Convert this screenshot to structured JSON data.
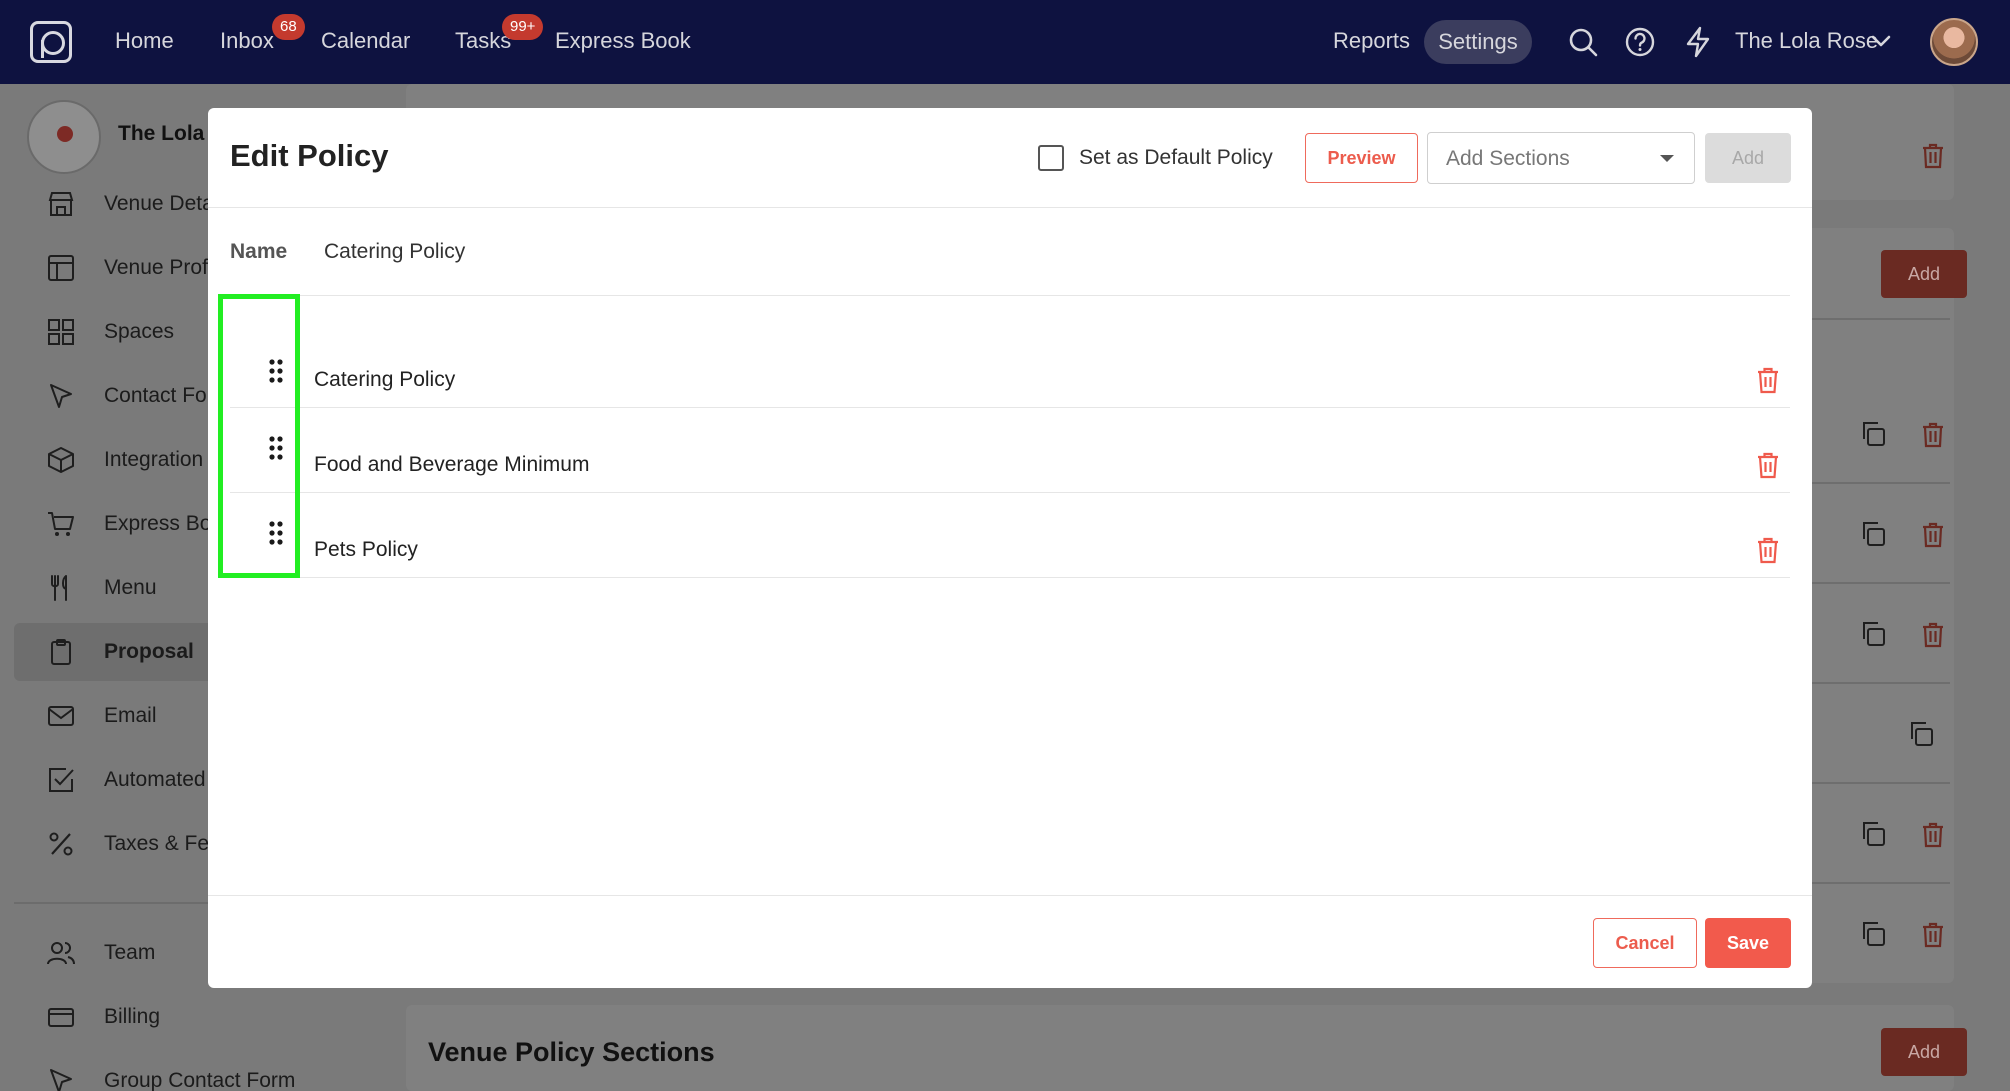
{
  "nav": {
    "home": "Home",
    "inbox": "Inbox",
    "inbox_badge": "68",
    "calendar": "Calendar",
    "tasks": "Tasks",
    "tasks_badge": "99+",
    "express_book": "Express Book",
    "reports": "Reports",
    "settings": "Settings",
    "account": "The Lola Rose"
  },
  "sidebar": {
    "venue_name": "The Lola R",
    "items": [
      {
        "label": "Venue Deta",
        "icon": "store-icon"
      },
      {
        "label": "Venue Prof",
        "icon": "layout-icon"
      },
      {
        "label": "Spaces",
        "icon": "grid-icon"
      },
      {
        "label": "Contact Fo",
        "icon": "cursor-icon"
      },
      {
        "label": "Integration",
        "icon": "box-icon"
      },
      {
        "label": "Express Bo",
        "icon": "cart-icon"
      },
      {
        "label": "Menu",
        "icon": "utensils-icon"
      },
      {
        "label": "Proposal",
        "icon": "clipboard-icon"
      },
      {
        "label": "Email",
        "icon": "mail-icon"
      },
      {
        "label": "Automated",
        "icon": "checkbox-icon"
      },
      {
        "label": "Taxes & Fe",
        "icon": "percent-icon"
      },
      {
        "label": "Team",
        "icon": "users-icon"
      },
      {
        "label": "Billing",
        "icon": "card-icon"
      },
      {
        "label": "Group Contact Form",
        "icon": "cursor-icon"
      }
    ]
  },
  "background": {
    "add_label": "Add",
    "venue_policy_sections": "Venue Policy Sections"
  },
  "modal": {
    "title": "Edit Policy",
    "default_label": "Set as Default Policy",
    "default_checked": false,
    "preview_label": "Preview",
    "add_sections_placeholder": "Add Sections",
    "add_label": "Add",
    "name_label": "Name",
    "name_value": "Catering Policy",
    "policies": [
      "Catering Policy",
      "Food and Beverage Minimum",
      "Pets Policy"
    ],
    "cancel_label": "Cancel",
    "save_label": "Save"
  },
  "colors": {
    "nav_bg": "#0e1240",
    "accent": "#f25a4c",
    "highlight": "#22ee22"
  }
}
